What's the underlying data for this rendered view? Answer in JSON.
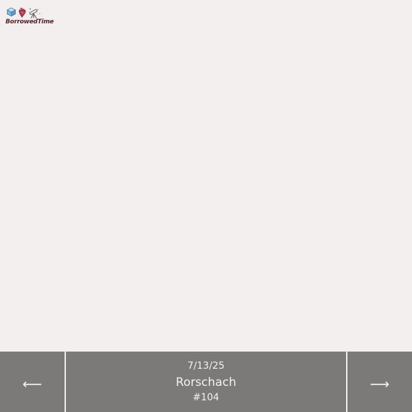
{
  "logo": {
    "wordmark": "BorrowedTime",
    "icons": [
      "cube-icon",
      "anatomical-heart-icon",
      "telescope-icon"
    ]
  },
  "entry": {
    "date": "7/13/25",
    "title": "Rorschach",
    "number": "#104"
  },
  "navigation": {
    "prev_icon": "left-arrow-icon",
    "prev_glyph": "⟵",
    "next_icon": "right-arrow-icon",
    "next_glyph": "⟶"
  },
  "colors": {
    "background": "#f3efee",
    "bar": "#7b7a79",
    "bar_text": "#f4f2f1",
    "wordmark": "#5b1f2e"
  }
}
